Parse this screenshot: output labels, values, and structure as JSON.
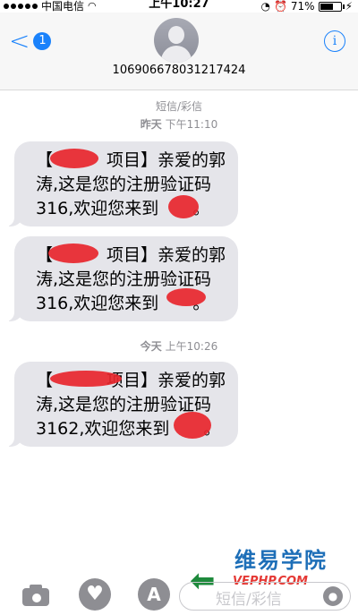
{
  "status_bar": {
    "carrier": "中国电信",
    "time": "上午10:27",
    "battery": "71%",
    "battery_level": 0.71
  },
  "header": {
    "back_badge": "1",
    "contact_number": "106906678031217424",
    "info_label": "i"
  },
  "conversation": {
    "service_label": "短信/彩信",
    "timestamps": [
      {
        "day": "昨天",
        "time": "下午11:10"
      },
      {
        "day": "今天",
        "time": "上午10:26"
      }
    ],
    "messages": [
      {
        "line1": "【",
        "line1_mid": "项目】亲爱的郭",
        "line2": "涛,这是您的注册验证码",
        "line3": "316,欢迎您来到",
        "line3_end": "。"
      },
      {
        "line1": "【",
        "line1_mid": "项目】亲爱的郭",
        "line2": "涛,这是您的注册验证码",
        "line3": "316,欢迎您来到",
        "line3_end": "。"
      },
      {
        "line1": "【",
        "line1_mid": "项目】亲爱的郭",
        "line2": "涛,这是您的注册验证码",
        "line3": "3162,欢迎您来到",
        "line3_end": "。"
      }
    ]
  },
  "toolbar": {
    "input_placeholder": "短信/彩信",
    "icons": [
      "camera-icon",
      "heart-touch-icon",
      "app-store-icon",
      "mic-icon"
    ]
  },
  "watermark": {
    "title": "维易学院",
    "subtitle": "VEPHP.COM"
  }
}
